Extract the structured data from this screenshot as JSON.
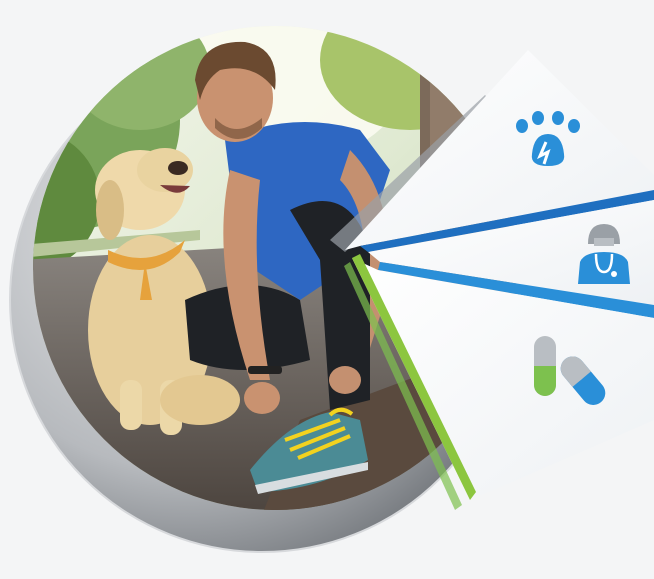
{
  "graphic": {
    "photo": {
      "subject": "photo-man-tying-shoe-with-dog",
      "colors": {
        "sky": "#eef3e6",
        "trees": "#6f9a4a",
        "road": "#5f5650",
        "dog": "#e7cf9c",
        "collar": "#e6a23c",
        "shirt": "#2e67c2",
        "pants": "#1f2226",
        "skin": "#c99270",
        "hair": "#6b4a30",
        "shoe": "#4b8b95",
        "laces": "#f2d21f"
      }
    },
    "ring_shadow_color": "#8a8d92",
    "panels": [
      {
        "icon": "paw-icon",
        "accent": "#2a8fd8",
        "stripe": "#1f6fc0"
      },
      {
        "icon": "vet-doctor-icon",
        "accent": "#2a8fd8",
        "stripe": "#2a8fd8"
      },
      {
        "icon": "capsule-pill-icon",
        "accent": "#7dc14e",
        "stripe": "#8cc63f"
      }
    ]
  }
}
